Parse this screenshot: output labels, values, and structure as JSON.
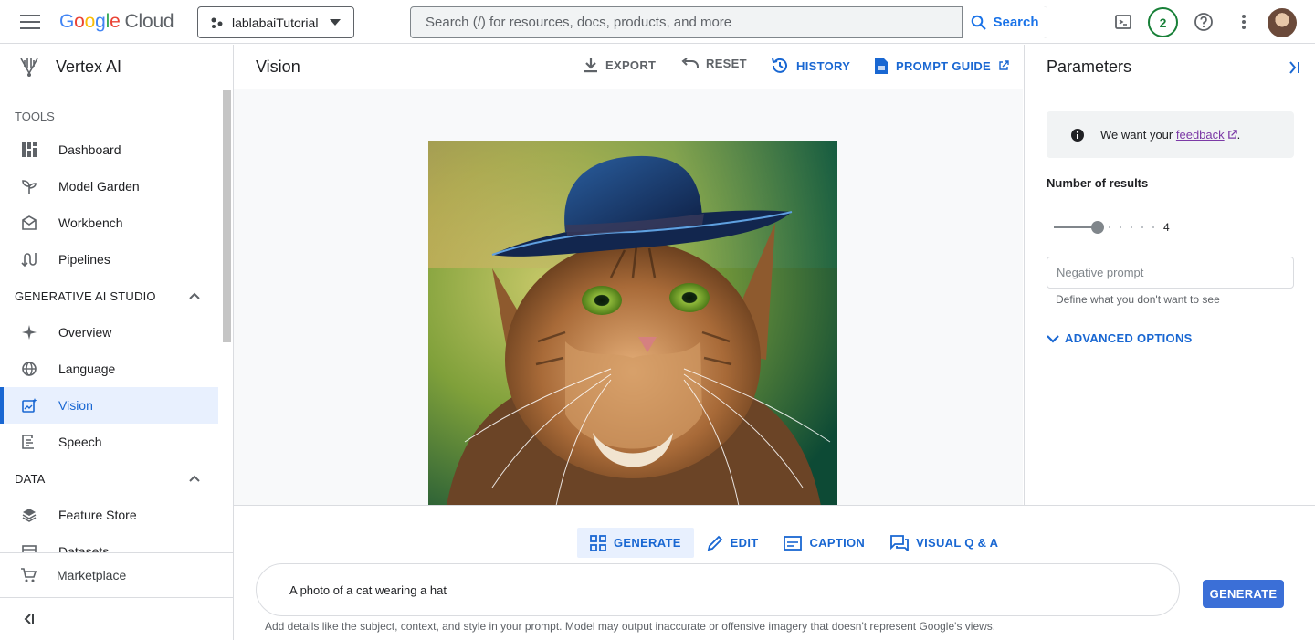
{
  "topbar": {
    "logo_google": "Google",
    "logo_cloud": "Cloud",
    "project": "lablabaiTutorial",
    "search_placeholder": "Search (/) for resources, docs, products, and more",
    "search_button": "Search",
    "notifications_count": "2"
  },
  "sidebar": {
    "title": "Vertex AI",
    "section_tools": "TOOLS",
    "tools": [
      {
        "label": "Dashboard",
        "icon": "dashboard-icon"
      },
      {
        "label": "Model Garden",
        "icon": "sprout-icon"
      },
      {
        "label": "Workbench",
        "icon": "workbench-icon"
      },
      {
        "label": "Pipelines",
        "icon": "pipelines-icon"
      }
    ],
    "group_genai": "GENERATIVE AI STUDIO",
    "genai": [
      {
        "label": "Overview",
        "icon": "sparkle-icon"
      },
      {
        "label": "Language",
        "icon": "globe-icon"
      },
      {
        "label": "Vision",
        "icon": "vision-icon"
      },
      {
        "label": "Speech",
        "icon": "speech-icon"
      }
    ],
    "group_data": "DATA",
    "data": [
      {
        "label": "Feature Store",
        "icon": "layers-icon"
      },
      {
        "label": "Datasets",
        "icon": "table-icon"
      }
    ],
    "marketplace": "Marketplace"
  },
  "main": {
    "title": "Vision",
    "toolbar": {
      "export": "EXPORT",
      "reset": "RESET",
      "history": "HISTORY",
      "prompt_guide": "PROMPT GUIDE"
    },
    "image_alt": "Generated image of a cat wearing a blue hat"
  },
  "parameters": {
    "title": "Parameters",
    "feedback_prefix": "We want your",
    "feedback_link": "feedback",
    "feedback_suffix": ".",
    "number_of_results_label": "Number of results",
    "number_of_results_value": "4",
    "negative_prompt_placeholder": "Negative prompt",
    "negative_prompt_hint": "Define what you don't want to see",
    "advanced_options": "ADVANCED OPTIONS"
  },
  "bottom": {
    "modes": [
      {
        "label": "GENERATE",
        "icon": "grid-icon"
      },
      {
        "label": "EDIT",
        "icon": "pencil-icon"
      },
      {
        "label": "CAPTION",
        "icon": "caption-icon"
      },
      {
        "label": "VISUAL Q & A",
        "icon": "chat-icon"
      }
    ],
    "prompt_value": "A photo of a cat wearing a hat",
    "generate_button": "GENERATE",
    "disclaimer": "Add details like the subject, context, and style in your prompt. Model may output inaccurate or offensive imagery that doesn't represent Google's views."
  },
  "colors": {
    "accent": "#1967d2",
    "button": "#3b6fd7",
    "badge": "#188038"
  }
}
